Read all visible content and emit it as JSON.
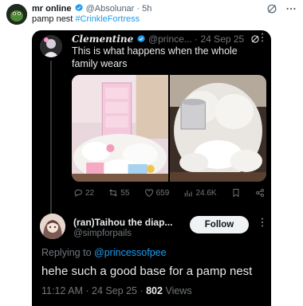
{
  "outer": {
    "name": "mr online",
    "handle": "@Absolunar",
    "separator": "·",
    "time": "5h",
    "text": "pamp nest",
    "hashtag": "#CrinkleFortress"
  },
  "quoted": {
    "name": "Clementine",
    "handle": "@prince...",
    "date": "· 24 Sep 25",
    "text": "This is what happens when the whole family wears",
    "stats": {
      "replies": "22",
      "retweets": "55",
      "likes": "659",
      "views": "24.6K"
    }
  },
  "reply": {
    "name": "(ran)Taihou the diap...",
    "handle": "@simpforpails",
    "follow_label": "Follow",
    "replying_prefix": "Replying to",
    "replying_handle": "@princessofpee",
    "text": "hehe such a good base for a pamp nest",
    "time": "11:12 AM · 24 Sep 25 ·",
    "views_count": "802",
    "views_label": "Views"
  },
  "colors": {
    "accent": "#1d9bf0",
    "verified": "#1d9bf0",
    "dark_bg": "#000000"
  },
  "icons": [
    "grok-icon",
    "more-icon",
    "reply-icon",
    "retweet-icon",
    "like-icon",
    "views-icon",
    "bookmark-icon",
    "share-icon"
  ]
}
